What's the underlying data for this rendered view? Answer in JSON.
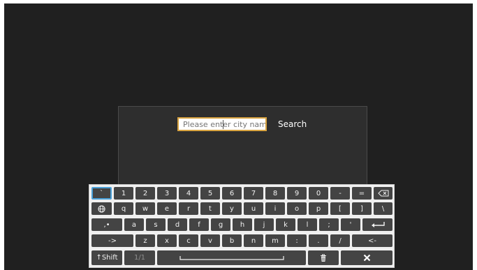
{
  "search": {
    "placeholder": "Please enter city name",
    "button_label": "Search"
  },
  "keyboard": {
    "row1": [
      "`",
      "1",
      "2",
      "3",
      "4",
      "5",
      "6",
      "7",
      "8",
      "9",
      "0",
      "-",
      "="
    ],
    "row2": [
      "q",
      "w",
      "e",
      "r",
      "t",
      "y",
      "u",
      "i",
      "o",
      "p",
      "[",
      "]",
      "\\"
    ],
    "row3": [
      ",•",
      "a",
      "s",
      "d",
      "f",
      "g",
      "h",
      "j",
      "k",
      "l",
      ";",
      "'"
    ],
    "row4": [
      "->",
      "z",
      "x",
      "c",
      "v",
      "b",
      "n",
      "m",
      ":",
      ".",
      "/",
      "<-"
    ],
    "shift_label": "↑Shift",
    "page_indicator": "1/1",
    "icons": {
      "backspace": "backspace-icon",
      "globe": "globe-icon",
      "enter": "enter-icon",
      "space": "space-bar-icon",
      "delete": "trash-icon",
      "close": "close-icon"
    },
    "colors": {
      "key": "#444444",
      "keyboard_bg": "#f0f0f0",
      "selected_border": "#4aa0d8",
      "input_border": "#d9a441"
    }
  }
}
